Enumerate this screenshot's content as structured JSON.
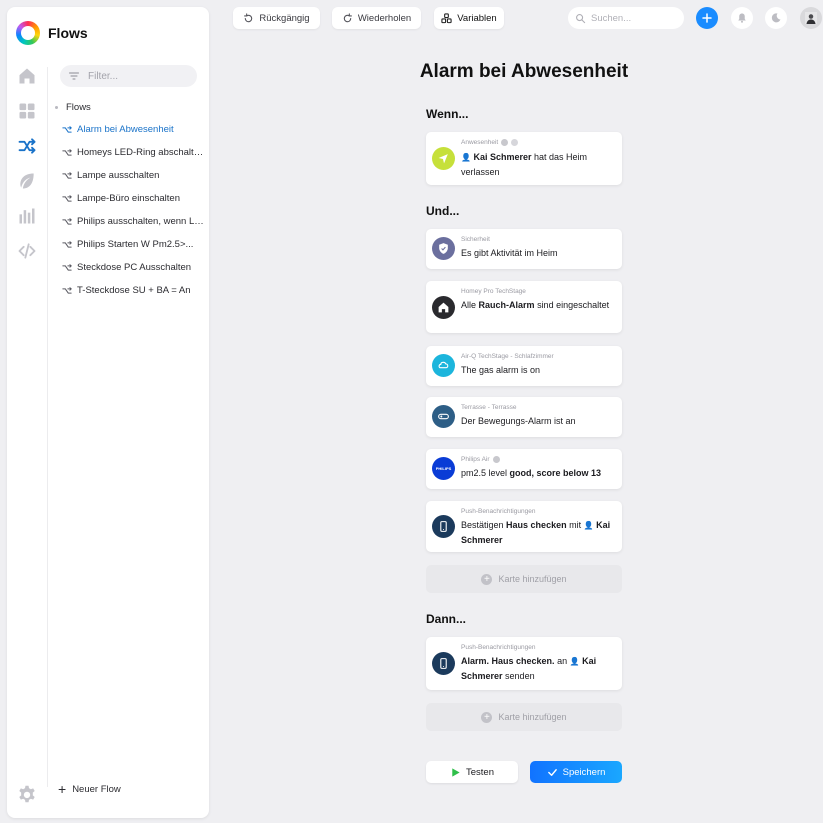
{
  "app": {
    "title": "Flows"
  },
  "sidebar": {
    "filter_placeholder": "Filter...",
    "root_label": "Flows",
    "flows": [
      {
        "label": "Alarm bei Abwesenheit",
        "active": true
      },
      {
        "label": "Homeys LED-Ring abschalten"
      },
      {
        "label": "Lampe ausschalten"
      },
      {
        "label": "Lampe-Büro einschalten"
      },
      {
        "label": "Philips ausschalten, wenn Luft gut"
      },
      {
        "label": "Philips Starten W Pm2.5>..."
      },
      {
        "label": "Steckdose PC Ausschalten"
      },
      {
        "label": "T-Steckdose SU + BA = An"
      }
    ],
    "new_flow_label": "Neuer Flow",
    "nav_icons": [
      "home-icon",
      "dashboard-icon",
      "flows-icon",
      "energy-icon",
      "insights-icon",
      "code-icon",
      "settings-icon"
    ]
  },
  "toolbar": {
    "undo_label": "Rückgängig",
    "redo_label": "Wiederholen",
    "variables_label": "Variablen",
    "search_placeholder": "Suchen..."
  },
  "flow": {
    "title": "Alarm bei Abwesenheit",
    "when_label": "Wenn...",
    "and_label": "Und...",
    "then_label": "Dann...",
    "when_card": {
      "source": "Anwesenheit",
      "name": "Kai Schmerer",
      "text_after": "hat das Heim verlassen",
      "icon_color": "#c6e03a"
    },
    "conditions": [
      {
        "source": "Sicherheit",
        "text": "Es gibt Aktivität im Heim",
        "icon_color": "#6b6f9e",
        "icon": "shield-icon"
      },
      {
        "source": "Homey Pro TechStage",
        "text_before": "Alle",
        "bold": "Rauch-Alarm",
        "text_after": "sind eingeschaltet",
        "icon_color": "#2a2a2e",
        "icon": "house-icon"
      },
      {
        "source": "Air-Q TechStage - Schlafzimmer",
        "text": "The gas alarm is on",
        "icon_color": "#1cb5dc",
        "icon": "sensor-icon"
      },
      {
        "source": "Terrasse - Terrasse",
        "text": "Der Bewegungs-Alarm ist an",
        "icon_color": "#2d5e86",
        "icon": "motion-sensor-icon"
      },
      {
        "source": "Philips Air",
        "text_before": "pm2.5 level",
        "bold": "good, score below 13",
        "icon_color": "#0a3cd6",
        "icon": "philips-icon",
        "brand": "PHILIPS"
      },
      {
        "source": "Push-Benachrichtigungen",
        "text_before": "Bestätigen",
        "bold": "Haus checken",
        "text_mid": "mit",
        "name": "Kai Schmerer",
        "icon_color": "#1b3a5c",
        "icon": "phone-icon"
      }
    ],
    "add_card_label": "Karte hinzufügen",
    "actions": [
      {
        "source": "Push-Benachrichtigungen",
        "bold": "Alarm. Haus checken.",
        "text_mid": "an",
        "name": "Kai Schmerer",
        "text_after": "senden",
        "icon_color": "#1b3a5c",
        "icon": "phone-icon"
      }
    ],
    "test_label": "Testen",
    "save_label": "Speichern"
  },
  "colors": {
    "accent": "#1a8cff",
    "active_flow": "#1a73c9",
    "test_play": "#2fbf4a"
  }
}
